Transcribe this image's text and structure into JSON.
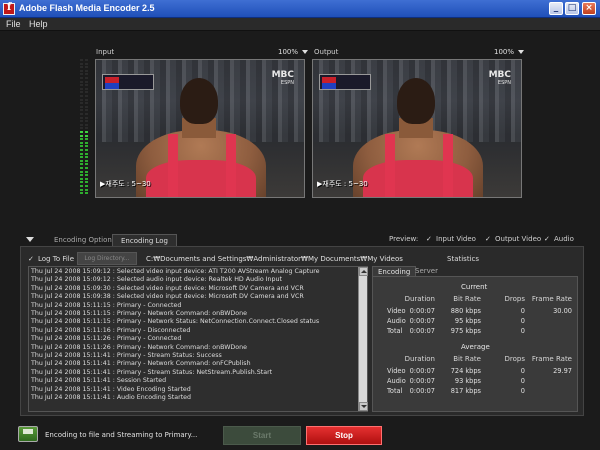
{
  "window": {
    "title": "Adobe Flash Media Encoder 2.5"
  },
  "menu": {
    "items": [
      "File",
      "Help"
    ]
  },
  "input_pane": {
    "label": "Input",
    "zoom": "100%",
    "caption": "▶재주도 : 5~30"
  },
  "output_pane": {
    "label": "Output",
    "zoom": "100%",
    "caption": "▶재주도 : 5~30"
  },
  "video_overlay": {
    "logo": "MBC",
    "logo_sub": "ESPN"
  },
  "tabs": {
    "encoding_options": "Encoding Options",
    "encoding_log": "Encoding Log"
  },
  "preview": {
    "label": "Preview:",
    "input_video": "Input Video",
    "output_video": "Output Video",
    "audio": "Audio"
  },
  "log": {
    "log_to_file": "Log To File",
    "log_directory_button": "Log Directory...",
    "path": "C:₩Documents and Settings₩Administrator₩My Documents₩My Videos",
    "lines": [
      "Thu Jul 24 2008 15:09:12 : Selected video input device: ATI T200 AVStream Analog Capture",
      "Thu Jul 24 2008 15:09:12 : Selected audio input device: Realtek HD Audio Input",
      "Thu Jul 24 2008 15:09:30 : Selected video input device: Microsoft DV Camera and VCR",
      "Thu Jul 24 2008 15:09:38 : Selected video input device: Microsoft DV Camera and VCR",
      "Thu Jul 24 2008 15:11:15 : Primary - Connected",
      "Thu Jul 24 2008 15:11:15 : Primary - Network Command: onBWDone",
      "Thu Jul 24 2008 15:11:15 : Primary - Network Status: NetConnection.Connect.Closed status",
      "Thu Jul 24 2008 15:11:16 : Primary - Disconnected",
      "Thu Jul 24 2008 15:11:26 : Primary - Connected",
      "Thu Jul 24 2008 15:11:26 : Primary - Network Command: onBWDone",
      "Thu Jul 24 2008 15:11:41 : Primary - Stream Status: Success",
      "Thu Jul 24 2008 15:11:41 : Primary - Network Command: onFCPublish",
      "Thu Jul 24 2008 15:11:41 : Primary - Stream Status: NetStream.Publish.Start",
      "Thu Jul 24 2008 15:11:41 : Session Started",
      "Thu Jul 24 2008 15:11:41 : Video Encoding Started",
      "Thu Jul 24 2008 15:11:41 : Audio Encoding Started"
    ]
  },
  "statistics": {
    "title": "Statistics",
    "tabs": [
      "Encoding",
      "Server"
    ],
    "current": {
      "label": "Current",
      "headers": [
        "Duration",
        "Bit Rate",
        "Drops",
        "Frame Rate"
      ],
      "rows": [
        {
          "name": "Video",
          "duration": "0:00:07",
          "bitrate": "880 kbps",
          "drops": "0",
          "framerate": "30.00"
        },
        {
          "name": "Audio",
          "duration": "0:00:07",
          "bitrate": "95 kbps",
          "drops": "0",
          "framerate": ""
        },
        {
          "name": "Total",
          "duration": "0:00:07",
          "bitrate": "975 kbps",
          "drops": "0",
          "framerate": ""
        }
      ]
    },
    "average": {
      "label": "Average",
      "headers": [
        "Duration",
        "Bit Rate",
        "Drops",
        "Frame Rate"
      ],
      "rows": [
        {
          "name": "Video",
          "duration": "0:00:07",
          "bitrate": "724 kbps",
          "drops": "0",
          "framerate": "29.97"
        },
        {
          "name": "Audio",
          "duration": "0:00:07",
          "bitrate": "93 kbps",
          "drops": "0",
          "framerate": ""
        },
        {
          "name": "Total",
          "duration": "0:00:07",
          "bitrate": "817 kbps",
          "drops": "0",
          "framerate": ""
        }
      ]
    }
  },
  "status": {
    "text": "Encoding to file and Streaming to Primary...",
    "start_label": "Start",
    "stop_label": "Stop"
  }
}
